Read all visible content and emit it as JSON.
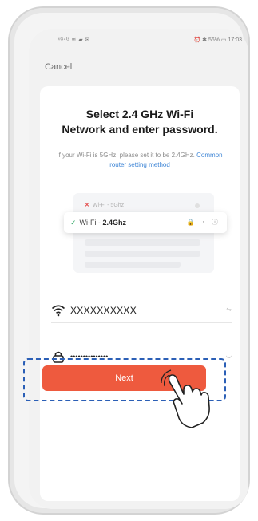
{
  "status_bar": {
    "left": "⁴ᴳ⁴ᴳ ≋ ▰ ✉",
    "right": "⏰ ✱ 56% ▭ 17:03"
  },
  "nav": {
    "cancel_label": "Cancel"
  },
  "page": {
    "title_line1": "Select 2.4 GHz Wi-Fi",
    "title_line2": "Network and enter password.",
    "subtitle_text": "If your Wi-Fi is 5GHz, please set it to be 2.4GHz.",
    "subtitle_link": "Common router setting method"
  },
  "illustration": {
    "bad_network_prefix": "Wi-Fi - ",
    "bad_network_band": "5Ghz",
    "good_network_prefix": "Wi-Fi - ",
    "good_network_band": "2.4Ghz"
  },
  "form": {
    "ssid_value": "XXXXXXXXXX",
    "password_value": "•••••••••••••••"
  },
  "buttons": {
    "next_label": "Next"
  },
  "colors": {
    "accent": "#ee5a3e",
    "link": "#3f86d6",
    "highlight_border": "#2b5fb6"
  }
}
